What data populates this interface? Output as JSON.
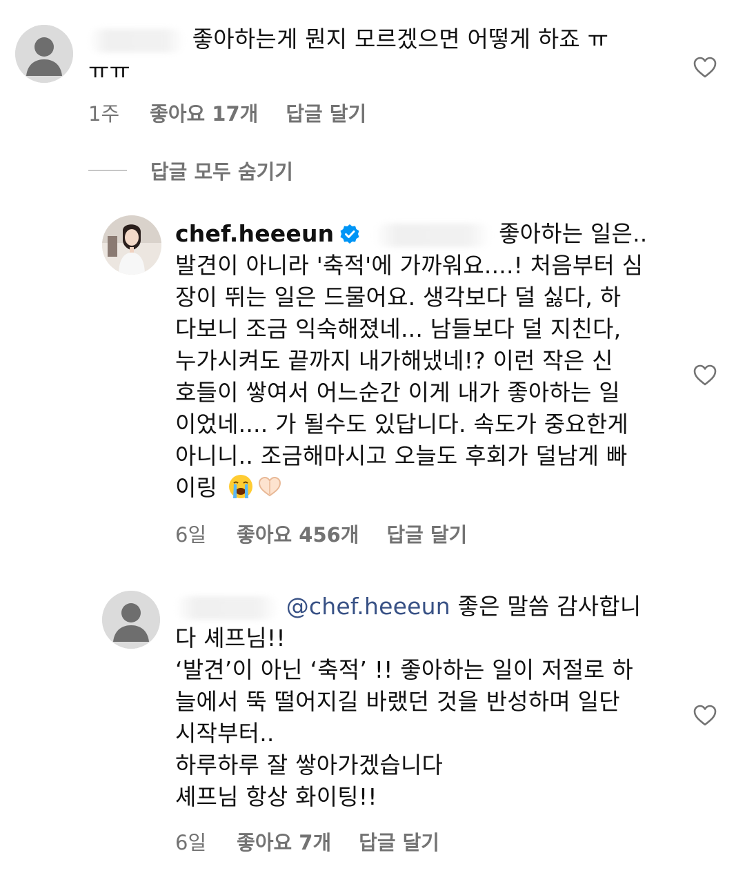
{
  "comments": [
    {
      "text_line1": "좋아하는게 뭔지 모르겠으면 어떻게 하죠 ㅠ",
      "text_line2": "ㅠㅠ",
      "time": "1주",
      "likes": "좋아요 17개",
      "reply": "답글 달기"
    }
  ],
  "hide_replies_label": "답글 모두 숨기기",
  "reply1": {
    "username": "chef.heeeun",
    "verified_icon": "verified-badge-icon",
    "text_first": "좋아하는 일은..",
    "text_rest": "발견이 아니라 '축적'에 가까워요....! 처음부터 심\n장이 뛰는 일은 드물어요. 생각보다 덜 싫다, 하\n다보니 조금 익숙해졌네... 남들보다 덜 지친다,\n누가시켜도 끝까지 내가해냈네!? 이런 작은 신\n호들이 쌓여서 어느순간 이게 내가 좋아하는 일\n이었네.... 가 될수도 있답니다. 속도가 중요한게\n아니니.. 조금해마시고 오늘도 후회가 덜남게 빠",
    "text_last": "이링",
    "emojis": [
      "loudly-crying-face-icon",
      "heart-hands-icon"
    ],
    "time": "6일",
    "likes": "좋아요 456개",
    "reply": "답글 달기"
  },
  "reply2": {
    "mention": "@chef.heeeun",
    "text_first": "좋은 말씀 감사합니",
    "text_rest": "다 셰프님!!\n‘발견’이 아닌 ‘축적’ !! 좋아하는 일이 저절로 하\n늘에서 뚝 떨어지길 바랬던 것을 반성하며 일단\n시작부터..\n하루하루 잘 쌓아가겠습니다\n셰프님 항상 화이팅!!",
    "time": "6일",
    "likes": "좋아요 7개",
    "reply": "답글 달기"
  },
  "colors": {
    "meta_gray": "#737373",
    "mention_blue": "#385185",
    "verified_blue": "#0095f6"
  }
}
